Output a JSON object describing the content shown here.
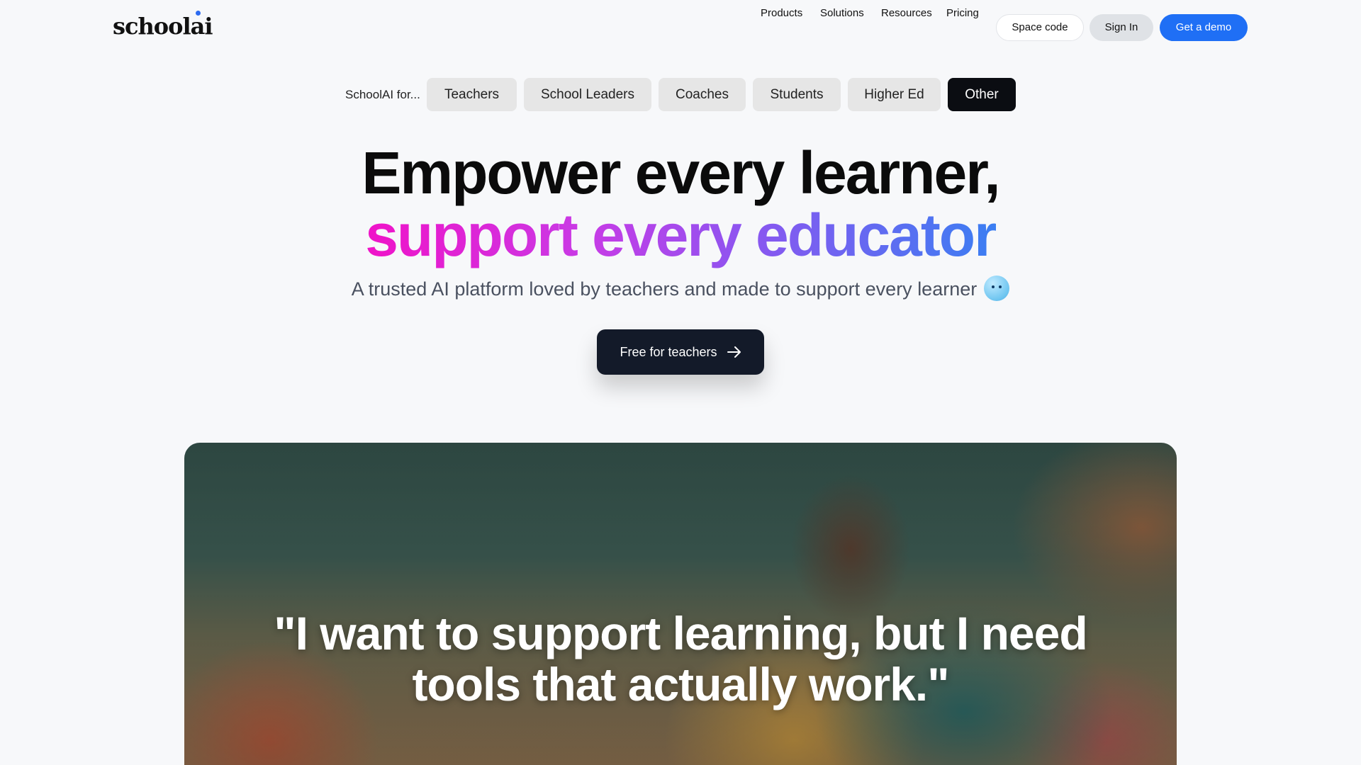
{
  "header": {
    "logo": "school",
    "logo_suffix": "ai",
    "nav": [
      "Products",
      "Solutions",
      "Resources",
      "Pricing"
    ],
    "space_code": "Space code",
    "sign_in": "Sign In",
    "get_demo": "Get a demo"
  },
  "audience": {
    "label": "SchoolAI for...",
    "tabs": [
      "Teachers",
      "School Leaders",
      "Coaches",
      "Students",
      "Higher Ed",
      "Other"
    ],
    "active": "Other"
  },
  "hero": {
    "line1": "Empower every learner,",
    "line2": "support every educator",
    "subtitle": "A trusted AI platform loved by teachers and made to support every learner",
    "cta": "Free for teachers"
  },
  "photo": {
    "quote_line1": "\"I want to support learning, but I need",
    "quote_line2": "tools that actually work.\""
  },
  "colors": {
    "brand_blue": "#1f6ff5",
    "dark_button": "#131a29",
    "gradient_start": "#f013c8",
    "gradient_end": "#3b7ef2"
  }
}
